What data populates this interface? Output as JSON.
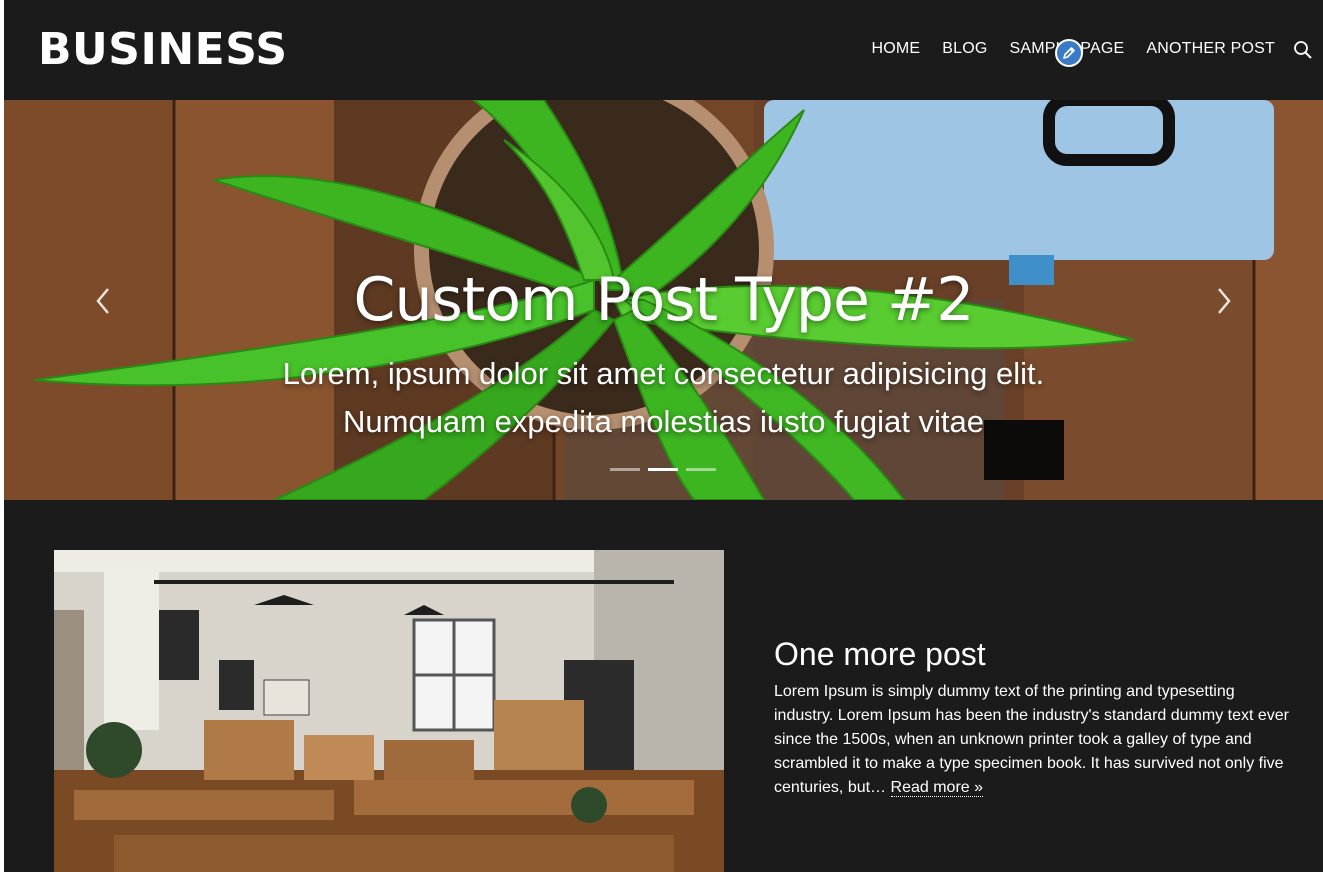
{
  "header": {
    "logo": "BUSINESS",
    "nav": [
      "HOME",
      "BLOG",
      "SAMPLE PAGE",
      "ANOTHER POST"
    ]
  },
  "hero": {
    "title": "Custom Post Type #2",
    "subtitle_line1": "Lorem, ipsum dolor sit amet consectetur adipisicing elit.",
    "subtitle_line2": "Numquam expedita molestias iusto fugiat vitae",
    "slides": 3,
    "active_slide": 2
  },
  "post": {
    "title": "One more post",
    "excerpt": "Lorem Ipsum is simply dummy text of the printing and typesetting industry. Lorem Ipsum has been the industry's standard dummy text ever since the 1500s, when an unknown printer took a galley of type and scrambled it to make a type specimen book. It has survived not only five centuries, but…",
    "read_more": "Read more »"
  },
  "icons": {
    "search": "search-icon",
    "edit": "pencil-icon",
    "prev": "chevron-left-icon",
    "next": "chevron-right-icon"
  },
  "colors": {
    "background": "#1b1b1b",
    "edit_badge": "#3b7bc6"
  }
}
